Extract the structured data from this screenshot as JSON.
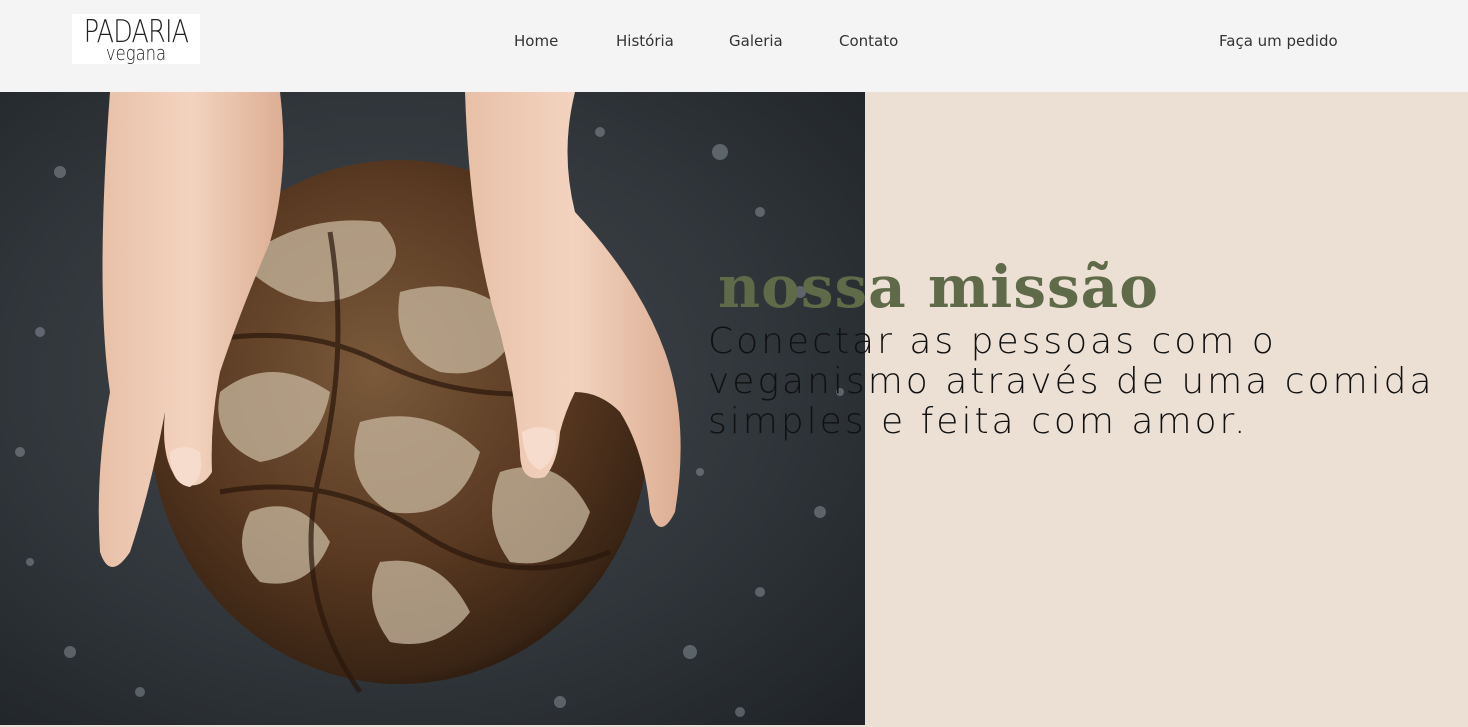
{
  "header": {
    "logo": {
      "line1": "PADARIA",
      "line2": "vegana"
    },
    "nav": [
      {
        "label": "Home"
      },
      {
        "label": "História"
      },
      {
        "label": "Galeria"
      },
      {
        "label": "Contato"
      }
    ],
    "order_link": "Faça um pedido"
  },
  "hero": {
    "image": "hands-holding-bread-photo",
    "title": "nossa missão",
    "text": "Conectar as pessoas com o veganismo através de uma comida simples e feita com amor."
  },
  "colors": {
    "header_bg": "#f4f4f4",
    "panel_bg": "#ece0d5",
    "title_green": "#5f6a48",
    "text_dark": "#111111"
  }
}
